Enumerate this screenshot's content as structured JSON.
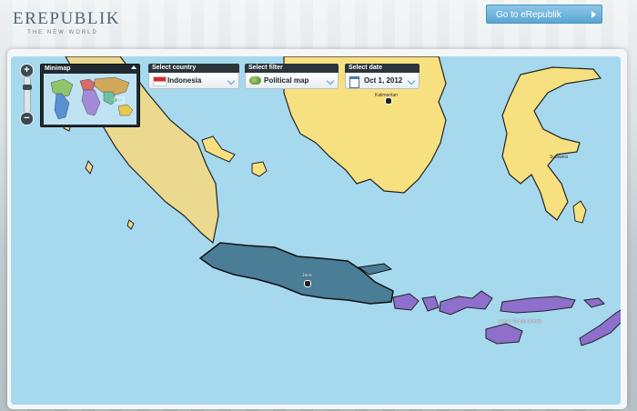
{
  "header": {
    "logo_text": "EREPUBLIK",
    "logo_tagline": "THE NEW WORLD",
    "go_button_label": "Go to eRepublik"
  },
  "minimap": {
    "title": "Minimap"
  },
  "controls": {
    "zoom_in": "+",
    "zoom_out": "−",
    "country": {
      "title": "Select country",
      "value": "Indonesia"
    },
    "filter": {
      "title": "Select filter",
      "value": "Political map"
    },
    "date": {
      "title": "Select date",
      "value": "Oct 1, 2012"
    }
  },
  "map_labels": {
    "kalimantan": "Kalimantan",
    "sulawesi": "Sulawesi",
    "java": "Java",
    "lesser_sunda": "Lesser Sunda Islands"
  },
  "colors": {
    "sea": "#a6d9ee",
    "sumatra_region": "#ead98f",
    "yellow_region": "#f7e07f",
    "java_region": "#4a7d96",
    "purple_region": "#8e6fcc"
  }
}
